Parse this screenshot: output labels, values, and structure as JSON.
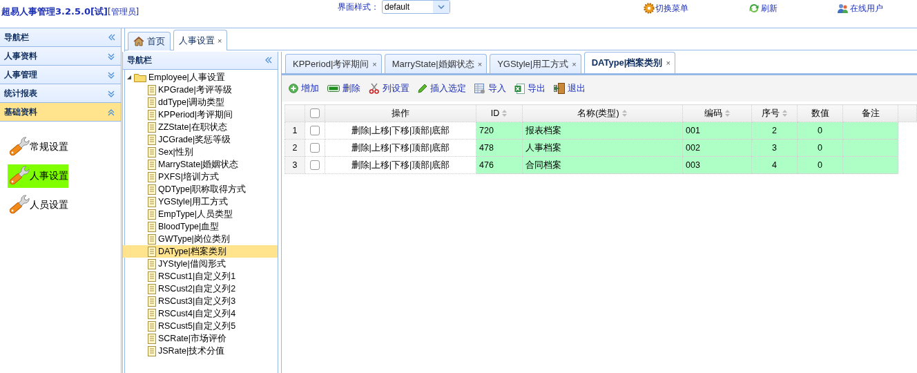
{
  "header": {
    "title": "超易人事管理3.2.5.0[试]",
    "role": "[管理员]",
    "style_label": "界面样式：",
    "style_value": "default",
    "actions": [
      {
        "label": "切换菜单"
      },
      {
        "label": "刷新"
      },
      {
        "label": "在线用户"
      }
    ]
  },
  "sidebar": {
    "title": "导航栏",
    "sections": [
      {
        "label": "人事资料",
        "expanded": false
      },
      {
        "label": "人事管理",
        "expanded": false
      },
      {
        "label": "统计报表",
        "expanded": false
      },
      {
        "label": "基础资料",
        "expanded": true
      }
    ],
    "items": [
      {
        "label": "常规设置",
        "selected": false
      },
      {
        "label": "人事设置",
        "selected": true
      },
      {
        "label": "人员设置",
        "selected": false
      }
    ]
  },
  "page_tabs": [
    {
      "label": "首页",
      "kind": "home",
      "selected": false
    },
    {
      "label": "人事设置",
      "kind": "page",
      "close": "×",
      "selected": true
    }
  ],
  "tree": {
    "title": "导航栏",
    "nodes": [
      {
        "label": "Employee|人事设置",
        "expanded": true,
        "selected": false,
        "children": [
          {
            "label": "KPGrade|考评等级",
            "selected": false
          },
          {
            "label": "ddType|调动类型",
            "selected": false
          },
          {
            "label": "KPPeriod|考评期间",
            "selected": false
          },
          {
            "label": "ZZState|在职状态",
            "selected": false
          },
          {
            "label": "JCGrade|奖惩等级",
            "selected": false
          },
          {
            "label": "Sex|性别",
            "selected": false
          },
          {
            "label": "MarryState|婚姻状态",
            "selected": false
          },
          {
            "label": "PXFS|培训方式",
            "selected": false
          },
          {
            "label": "QDType|职称取得方式",
            "selected": false
          },
          {
            "label": "YGStyle|用工方式",
            "selected": false
          },
          {
            "label": "EmpType|人员类型",
            "selected": false
          },
          {
            "label": "BloodType|血型",
            "selected": false
          },
          {
            "label": "GWType|岗位类别",
            "selected": false
          },
          {
            "label": "DAType|档案类别",
            "selected": true
          },
          {
            "label": "JYStyle|借阅形式",
            "selected": false
          },
          {
            "label": "RSCust1|自定义列1",
            "selected": false
          },
          {
            "label": "RSCust2|自定义列2",
            "selected": false
          },
          {
            "label": "RSCust3|自定义列3",
            "selected": false
          },
          {
            "label": "RSCust4|自定义列4",
            "selected": false
          },
          {
            "label": "RSCust5|自定义列5",
            "selected": false
          },
          {
            "label": "SCRate|市场评价",
            "selected": false
          },
          {
            "label": "JSRate|技术分值",
            "selected": false
          }
        ]
      }
    ]
  },
  "sub_tabs": [
    {
      "label": "KPPeriod|考评期间",
      "close": "×",
      "selected": false
    },
    {
      "label": "MarryState|婚姻状态",
      "close": "×",
      "selected": false
    },
    {
      "label": "YGStyle|用工方式",
      "close": "×",
      "selected": false
    },
    {
      "label": "DAType|档案类别",
      "close": "×",
      "selected": true
    }
  ],
  "toolbar": [
    {
      "label": "增加"
    },
    {
      "label": "删除"
    },
    {
      "label": "列设置"
    },
    {
      "label": "插入选定"
    },
    {
      "label": "导入"
    },
    {
      "label": "导出"
    },
    {
      "label": "退出"
    }
  ],
  "table": {
    "header_checked": false,
    "columns": [
      {
        "label": "操作",
        "sortable": false
      },
      {
        "label": "ID",
        "sortable": true
      },
      {
        "label": "名称(类型)",
        "sortable": true
      },
      {
        "label": "编码",
        "sortable": true
      },
      {
        "label": "序号",
        "sortable": true
      },
      {
        "label": "数值",
        "sortable": false
      },
      {
        "label": "备注",
        "sortable": false
      }
    ],
    "rows": [
      {
        "number": "1",
        "checked": false,
        "highlighted": true,
        "cells": [
          "删除|上移|下移|顶部|底部",
          "720",
          "报表档案",
          "001",
          "2",
          "0"
        ]
      },
      {
        "number": "2",
        "checked": false,
        "highlighted": true,
        "cells": [
          "删除|上移|下移|顶部|底部",
          "478",
          "人事档案",
          "002",
          "3",
          "0"
        ]
      },
      {
        "number": "3",
        "checked": false,
        "highlighted": true,
        "cells": [
          "删除|上移|下移|顶部|底部",
          "476",
          "合同档案",
          "003",
          "4",
          "0"
        ]
      }
    ]
  }
}
